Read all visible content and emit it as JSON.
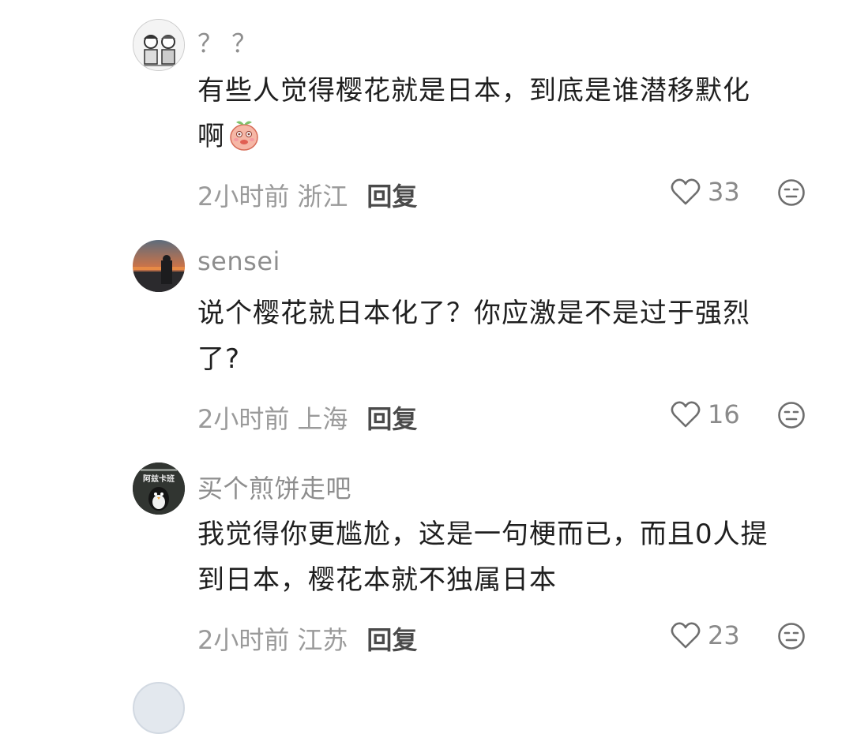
{
  "comments": [
    {
      "username": "？ ？",
      "content_lines": [
        "有些人觉得樱花就是日本，到底是谁潜移默化",
        "啊"
      ],
      "has_emoji": true,
      "time": "2小时前",
      "location": "浙江",
      "reply_label": "回复",
      "likes": "33"
    },
    {
      "username": "sensei",
      "content_lines": [
        "说个樱花就日本化了？你应激是不是过于强烈",
        "了?"
      ],
      "has_emoji": false,
      "time": "2小时前",
      "location": "上海",
      "reply_label": "回复",
      "likes": "16"
    },
    {
      "username": "买个煎饼走吧",
      "avatar_text": "阿兹卡班",
      "content_lines": [
        "我觉得你更尴尬，这是一句梗而已，而且0人提",
        "到日本，樱花本就不独属日本"
      ],
      "has_emoji": false,
      "time": "2小时前",
      "location": "江苏",
      "reply_label": "回复",
      "likes": "23"
    }
  ],
  "icons": {
    "like": "heart-outline-icon",
    "dislike": "neutral-face-icon"
  },
  "colors": {
    "username": "#8e8e8e",
    "content": "#1f1f1f",
    "meta": "#9a9a9a",
    "reply": "#4a4a4a"
  }
}
